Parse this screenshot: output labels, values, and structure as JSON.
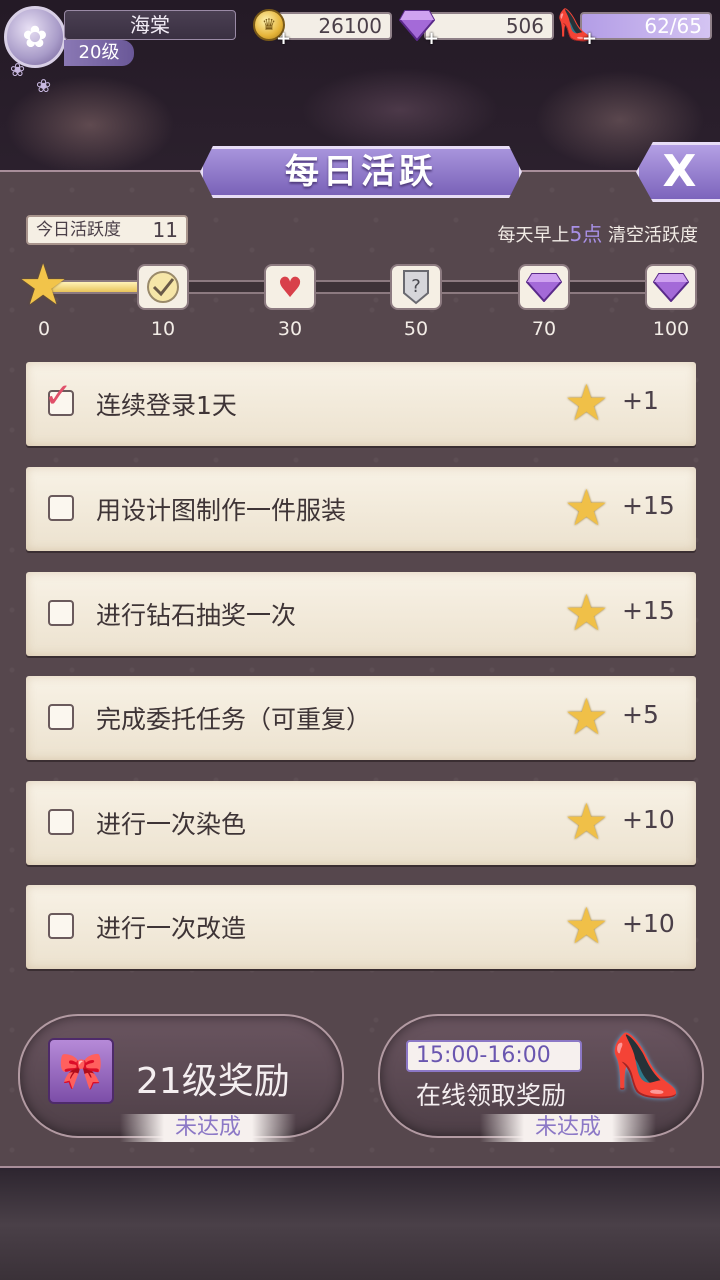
{
  "player": {
    "name": "海棠",
    "level": "20级",
    "gold": "26100",
    "diamonds": "506",
    "stamina": "62/65",
    "plus": "+"
  },
  "panel": {
    "title": "每日活跃",
    "close_label": "X",
    "today_label": "今日活跃度",
    "today_value": "11",
    "reset_prefix": "每天早上",
    "reset_hour": "5点",
    "reset_suffix": " 清空活跃度"
  },
  "progress": {
    "current": 11,
    "max": 100,
    "milestones": [
      {
        "value": "0",
        "icon": "star-icon"
      },
      {
        "value": "10",
        "icon": "checkmark-badge-icon"
      },
      {
        "value": "30",
        "icon": "heart-icon"
      },
      {
        "value": "50",
        "icon": "question-mark-icon"
      },
      {
        "value": "70",
        "icon": "diamond-icon"
      },
      {
        "value": "100",
        "icon": "diamond-icon"
      }
    ]
  },
  "tasks": [
    {
      "label": "连续登录1天",
      "points": "+1",
      "done": true
    },
    {
      "label": "用设计图制作一件服装",
      "points": "+15",
      "done": false
    },
    {
      "label": "进行钻石抽奖一次",
      "points": "+15",
      "done": false
    },
    {
      "label": "完成委托任务（可重复）",
      "points": "+5",
      "done": false
    },
    {
      "label": "进行一次染色",
      "points": "+10",
      "done": false
    },
    {
      "label": "进行一次改造",
      "points": "+10",
      "done": false
    }
  ],
  "rewards": {
    "level_reward": {
      "title": "21级奖励",
      "status": "未达成"
    },
    "online_reward": {
      "time": "15:00-16:00",
      "title": "在线领取奖励",
      "status": "未达成"
    }
  },
  "colors": {
    "accent_purple": "#7a62b8",
    "highlight": "#a890e6",
    "check_red": "#e0506a",
    "star_gold": "#f0c048"
  }
}
